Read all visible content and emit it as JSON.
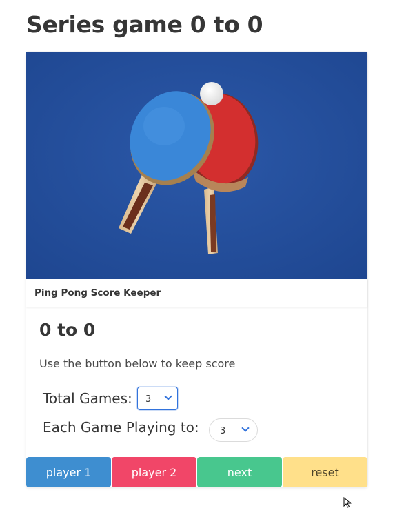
{
  "page": {
    "title": "Series game 0 to 0"
  },
  "card": {
    "header_title": "Ping Pong Score Keeper",
    "image_alt": "Two ping pong paddles and a ball on a blue background",
    "score_display": "0 to 0",
    "instructions": "Use the button below to keep score",
    "total_games": {
      "label": "Total Games:",
      "selected": "3"
    },
    "game_playing_to": {
      "label": "Each Game Playing to:",
      "selected": "3"
    },
    "buttons": {
      "player1": "player 1",
      "player2": "player 2",
      "next": "next",
      "reset": "reset"
    }
  },
  "colors": {
    "player1": "#3e8ed0",
    "player2": "#f14668",
    "next": "#48c78e",
    "reset": "#ffe08a",
    "image_bg": "#234c9a"
  },
  "icons": [
    "chevron-down-icon",
    "mouse-cursor-icon"
  ]
}
